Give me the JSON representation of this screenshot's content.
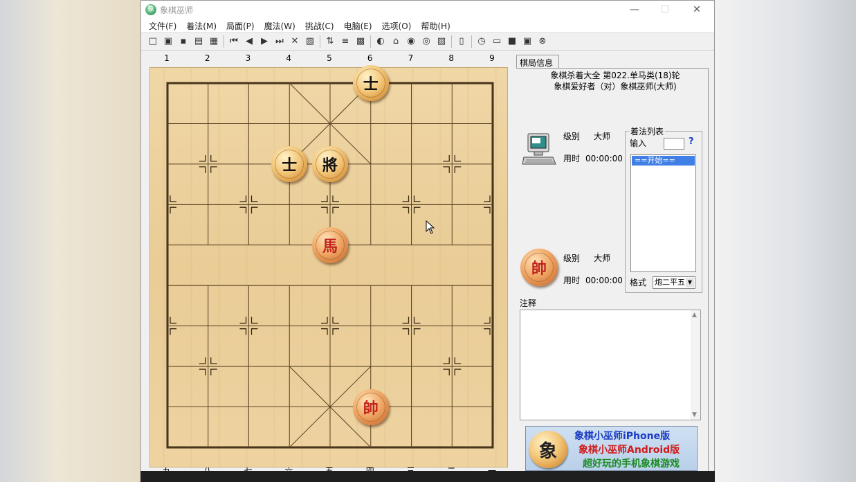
{
  "window": {
    "title": "象棋巫师",
    "app_icon_glyph": "象"
  },
  "menu": [
    "文件(F)",
    "着法(M)",
    "局面(P)",
    "魔法(W)",
    "挑战(C)",
    "电脑(E)",
    "选项(O)",
    "帮助(H)"
  ],
  "toolbar_icons": [
    "new-icon",
    "open-icon",
    "save-icon",
    "print-icon",
    "print-preview-icon",
    "sep",
    "first-move-icon",
    "prev-move-icon",
    "next-move-icon",
    "last-move-icon",
    "delete-icon",
    "paste-icon",
    "sep",
    "flip-board-icon",
    "tree-icon",
    "grid-icon",
    "sep",
    "chart-icon",
    "puzzle-icon",
    "weibo-icon",
    "web-icon",
    "clipboard-icon",
    "sep",
    "book-icon",
    "sep",
    "clock-icon",
    "engine-icon",
    "terminal-icon",
    "monitor-icon",
    "stop-icon"
  ],
  "board": {
    "column_labels_top": [
      "1",
      "2",
      "3",
      "4",
      "5",
      "6",
      "7",
      "8",
      "9"
    ],
    "column_labels_bottom": [
      "九",
      "八",
      "七",
      "六",
      "五",
      "四",
      "三",
      "二",
      "一"
    ],
    "pieces": [
      {
        "glyph": "士",
        "side": "black",
        "file": 5,
        "rank": 0
      },
      {
        "glyph": "士",
        "side": "black",
        "file": 3,
        "rank": 2
      },
      {
        "glyph": "將",
        "side": "black",
        "file": 4,
        "rank": 2
      },
      {
        "glyph": "馬",
        "side": "red",
        "file": 4,
        "rank": 4
      },
      {
        "glyph": "帥",
        "side": "red",
        "file": 5,
        "rank": 8
      }
    ]
  },
  "info": {
    "tab": "棋局信息",
    "game_title": "象棋杀着大全 第022.单马类(18)轮",
    "players": "象棋爱好者（对）象棋巫师(大师)",
    "top_player": {
      "level_label": "级别",
      "level": "大师",
      "time_label": "用时",
      "time": "00:00:00"
    },
    "bottom_player": {
      "level_label": "级别",
      "level": "大师",
      "time_label": "用时",
      "time": "00:00:00",
      "icon_glyph": "帥"
    },
    "movelist": {
      "title": "着法列表",
      "input_label": "输入",
      "help": "?",
      "first_move": "==开始==",
      "format_label": "格式",
      "format_value": "炮二平五"
    },
    "comment_label": "注释"
  },
  "ad": {
    "glyph": "象",
    "line1": "象棋小巫师iPhone版",
    "line2": "象棋小巫师Android版",
    "line3": "超好玩的手机象棋游戏"
  }
}
